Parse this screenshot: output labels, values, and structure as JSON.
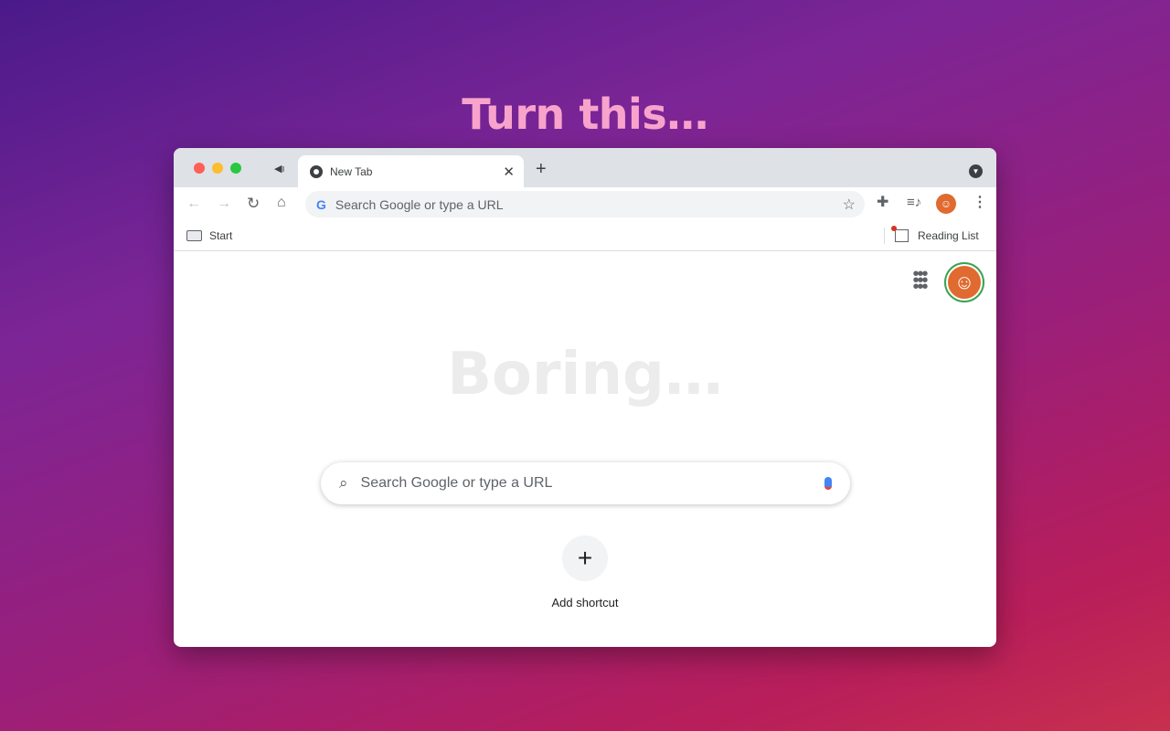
{
  "headline": "Turn this…",
  "colors": {
    "accent": "#f8a3cc",
    "avatar": "#e06a2f",
    "tabstrip": "#dee1e6"
  },
  "tab": {
    "title": "New Tab",
    "icon": "chrome-icon"
  },
  "omnibox": {
    "placeholder": "Search Google or type a URL"
  },
  "bookmarks": {
    "start": "Start",
    "reading_list": "Reading List"
  },
  "ntp": {
    "overlay_text": "Boring…",
    "search_placeholder": "Search Google or type a URL",
    "add_shortcut": "Add shortcut"
  }
}
